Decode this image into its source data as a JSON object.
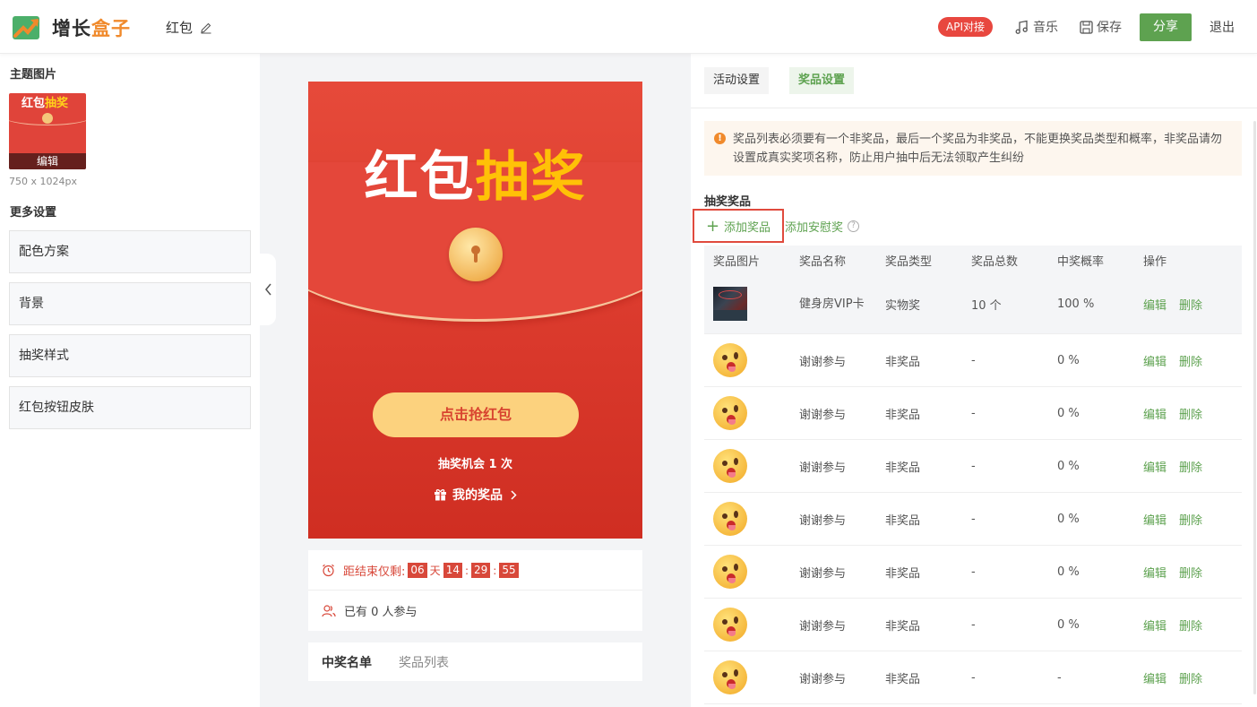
{
  "header": {
    "logo_text_main": "增长",
    "logo_text_accent": "盒子",
    "doc_title": "红包",
    "api_badge": "API对接",
    "music_label": "音乐",
    "save_label": "保存",
    "share_label": "分享",
    "logout_label": "退出"
  },
  "left": {
    "theme_title": "主题图片",
    "thumb_title_a": "红包",
    "thumb_title_b": "抽奖",
    "thumb_edit": "编辑",
    "image_size": "750 x 1024px",
    "more_settings": "更多设置",
    "settings": [
      {
        "label": "配色方案"
      },
      {
        "label": "背景"
      },
      {
        "label": "抽奖样式"
      },
      {
        "label": "红包按钮皮肤"
      }
    ]
  },
  "preview": {
    "title_a": "红包",
    "title_b": "抽奖",
    "grab_button": "点击抢红包",
    "chance": "抽奖机会 1 次",
    "my_prize": "我的奖品",
    "countdown_label": "距结束仅剩:",
    "countdown": {
      "days": "06",
      "day_unit": "天",
      "hours": "14",
      "minutes": "29",
      "seconds": "55",
      "sep": ":"
    },
    "participants": "已有 0 人参与",
    "tab_winners": "中奖名单",
    "tab_prizes": "奖品列表"
  },
  "right": {
    "tab_activity": "活动设置",
    "tab_prize": "奖品设置",
    "notice": "奖品列表必须要有一个非奖品，最后一个奖品为非奖品，不能更换奖品类型和概率，非奖品请勿设置成真实奖项名称，防止用户抽中后无法领取产生纠纷",
    "prize_section_title": "抽奖奖品",
    "add_prize": "添加奖品",
    "add_consolation": "添加安慰奖",
    "columns": [
      "奖品图片",
      "奖品名称",
      "奖品类型",
      "奖品总数",
      "中奖概率",
      "操作"
    ],
    "edit_label": "编辑",
    "delete_label": "删除",
    "rows": [
      {
        "name": "健身房VIP卡",
        "type": "实物奖",
        "total": "10 个",
        "rate": "100 %",
        "image": "gym"
      },
      {
        "name": "谢谢参与",
        "type": "非奖品",
        "total": "-",
        "rate": "0 %",
        "image": "emoji"
      },
      {
        "name": "谢谢参与",
        "type": "非奖品",
        "total": "-",
        "rate": "0 %",
        "image": "emoji"
      },
      {
        "name": "谢谢参与",
        "type": "非奖品",
        "total": "-",
        "rate": "0 %",
        "image": "emoji"
      },
      {
        "name": "谢谢参与",
        "type": "非奖品",
        "total": "-",
        "rate": "0 %",
        "image": "emoji"
      },
      {
        "name": "谢谢参与",
        "type": "非奖品",
        "total": "-",
        "rate": "0 %",
        "image": "emoji"
      },
      {
        "name": "谢谢参与",
        "type": "非奖品",
        "total": "-",
        "rate": "0 %",
        "image": "emoji"
      },
      {
        "name": "谢谢参与",
        "type": "非奖品",
        "total": "-",
        "rate": "-",
        "image": "emoji"
      }
    ]
  },
  "colors": {
    "brand_green": "#5ea250",
    "brand_orange": "#f08a2c",
    "red": "#e04a3d",
    "packet_red": "#d9382b",
    "gold": "#ffc107"
  }
}
